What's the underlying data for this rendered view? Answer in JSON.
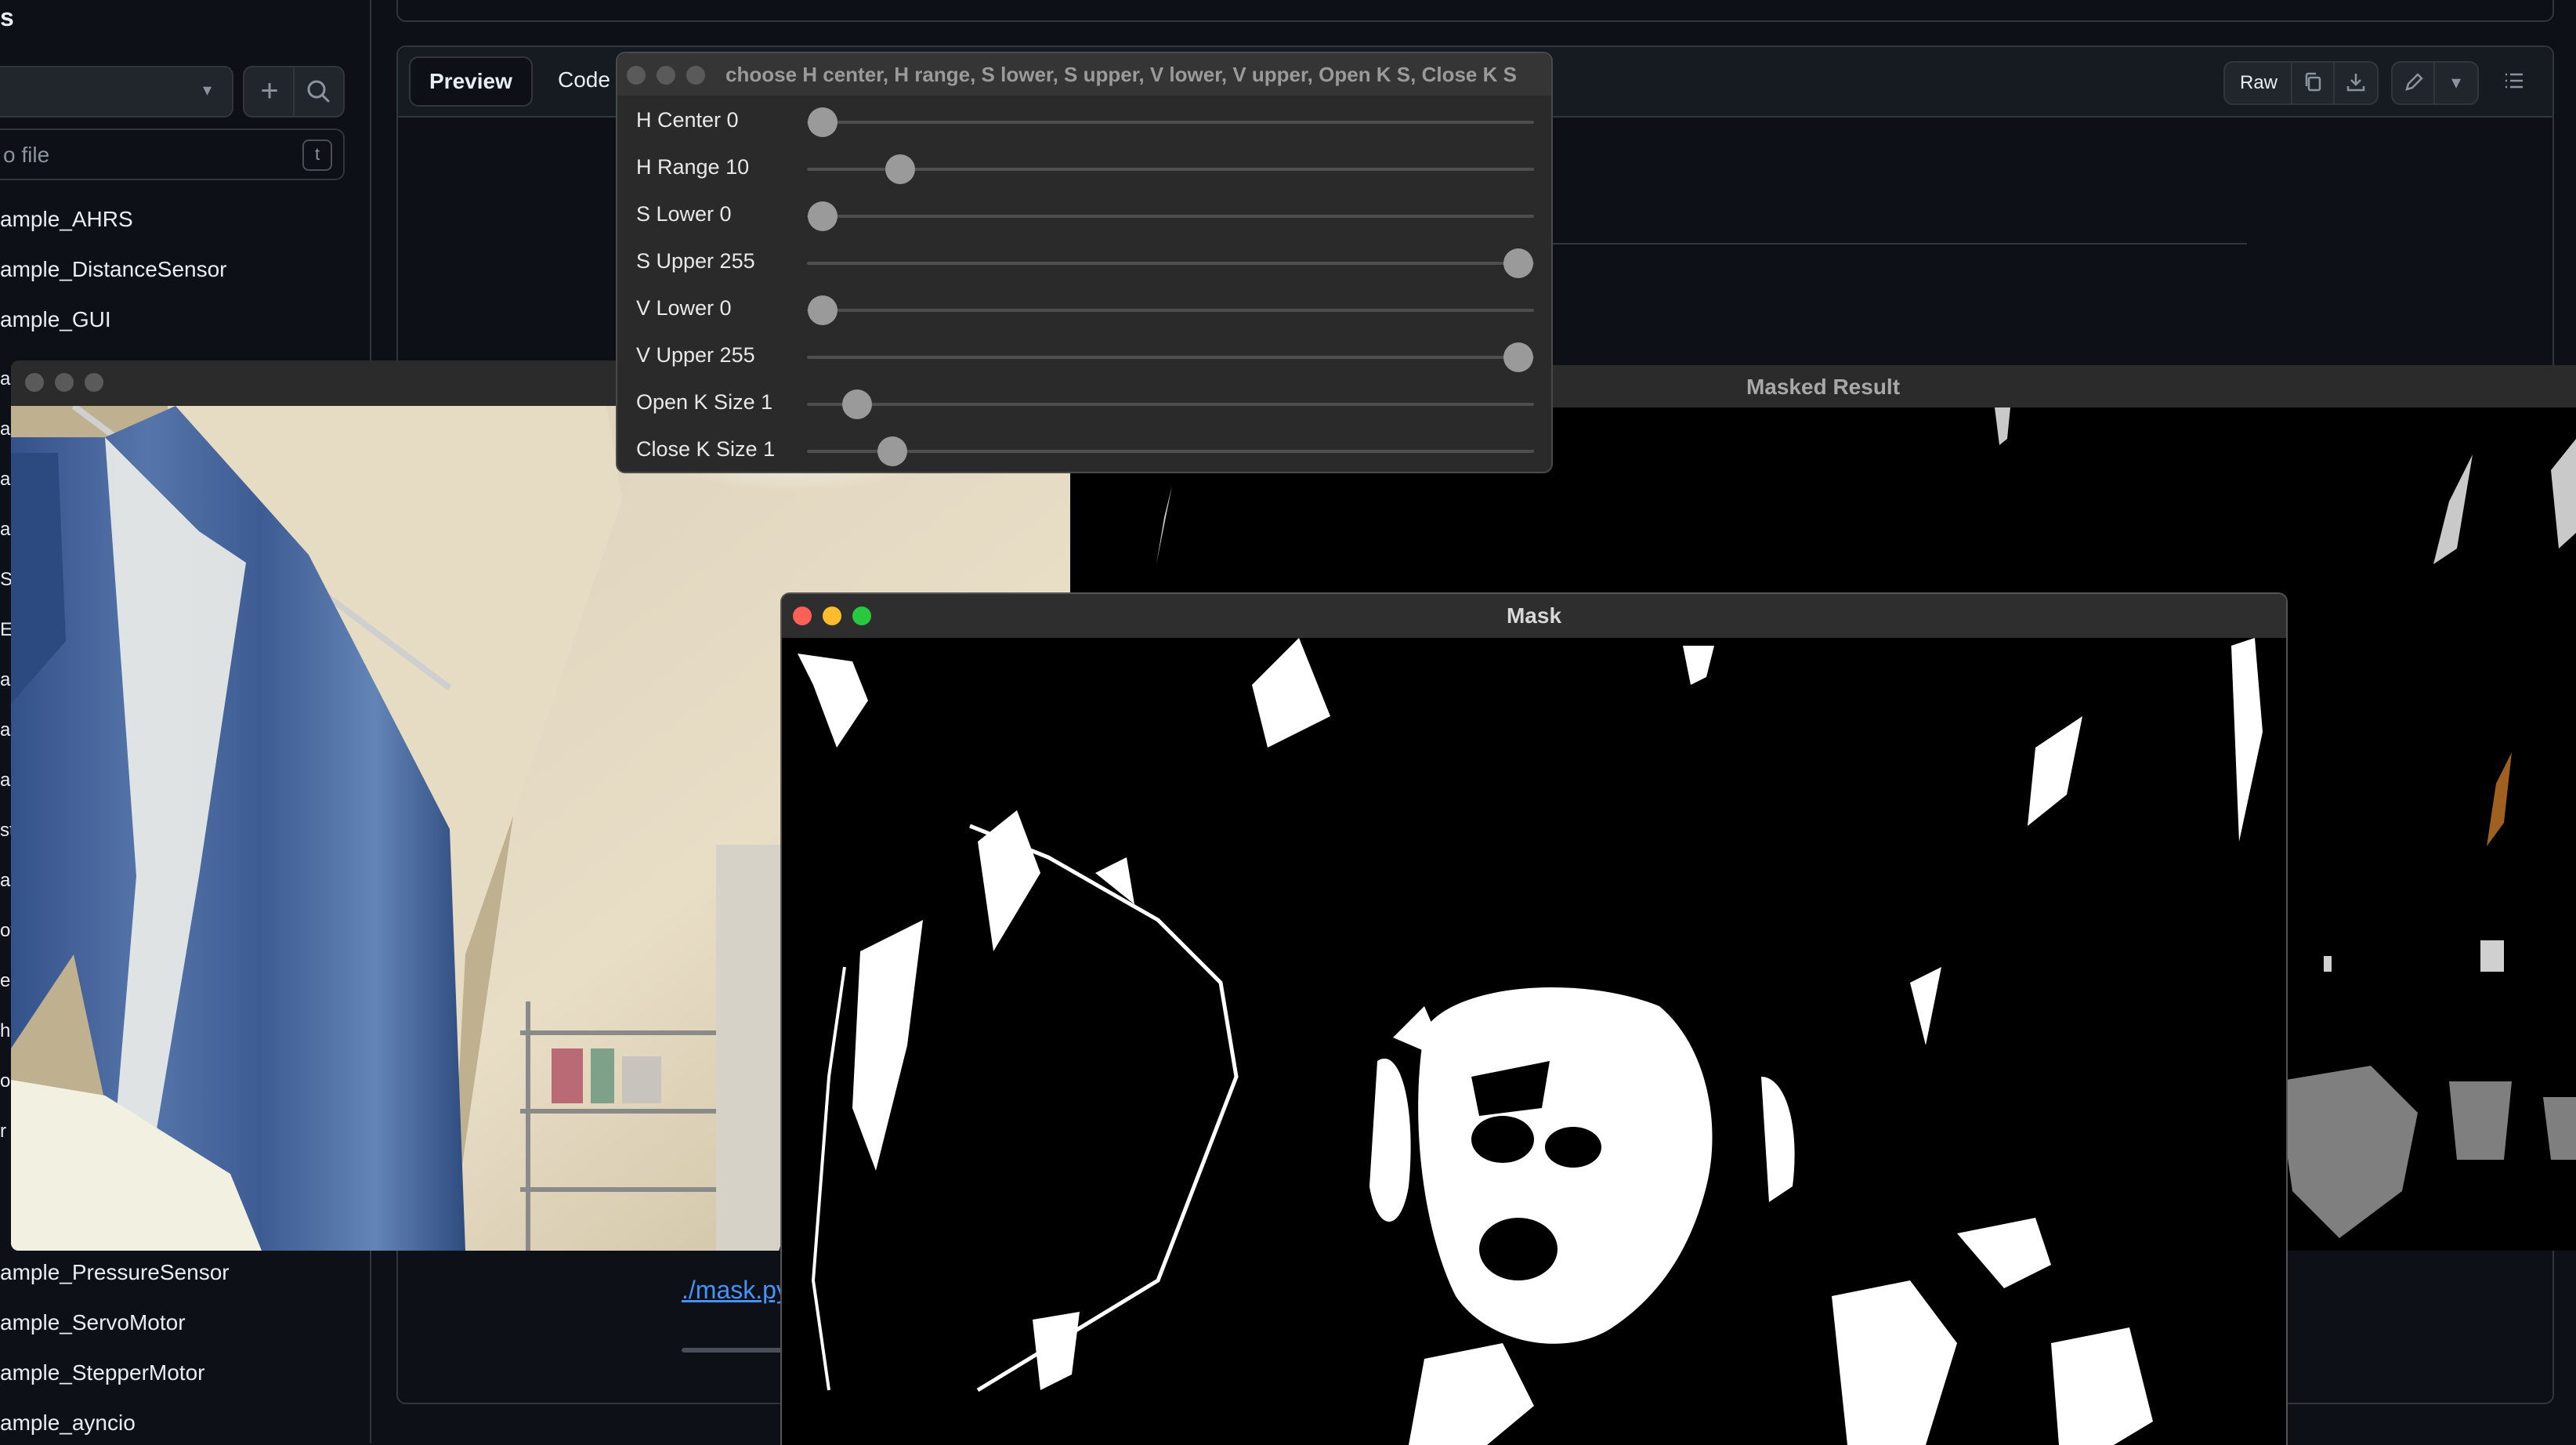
{
  "github": {
    "sidebar_heading": "s",
    "file_filter_placeholder": "o file",
    "file_filter_shortcut": "t",
    "tree_items_top": [
      "ample_AHRS",
      "ample_DistanceSensor",
      "ample_GUI"
    ],
    "tree_items_bottom": [
      "ample_PressureSensor",
      "ample_ServoMotor",
      "ample_StepperMotor",
      "ample_ayncio"
    ],
    "tree_letters_left": [
      "ar",
      "ar",
      "ar",
      "ar",
      "S",
      "E",
      "ar",
      "ar",
      "ar",
      "st",
      "ar",
      "ot",
      "e",
      "h",
      "o",
      "r"
    ],
    "tabs": {
      "preview": "Preview",
      "code": "Code"
    },
    "raw_label": "Raw",
    "mask_link": "./mask.py"
  },
  "trackbar_window": {
    "title": "choose H center, H range, S lower, S upper, V lower, V upper, Open K S, Close K S",
    "sliders": [
      {
        "label": "H Center 0",
        "value": 0,
        "max": 179
      },
      {
        "label": "H Range 10",
        "value": 10,
        "max": 90
      },
      {
        "label": "S Lower 0",
        "value": 0,
        "max": 255
      },
      {
        "label": "S Upper 255",
        "value": 255,
        "max": 255
      },
      {
        "label": "V Lower 0",
        "value": 0,
        "max": 255
      },
      {
        "label": "V Upper 255",
        "value": 255,
        "max": 255
      },
      {
        "label": "Open K Size 1",
        "value": 1,
        "max": 20
      },
      {
        "label": "Close K Size 1",
        "value": 1,
        "max": 10
      }
    ]
  },
  "masked_window": {
    "title": "Masked Result"
  },
  "mask_window": {
    "title": "Mask"
  },
  "colors": {
    "traffic_close": "#fe5f57",
    "traffic_min": "#febc2e",
    "traffic_max": "#28c840",
    "inactive_traffic": "#5a5a5a",
    "link": "#4493f8"
  }
}
